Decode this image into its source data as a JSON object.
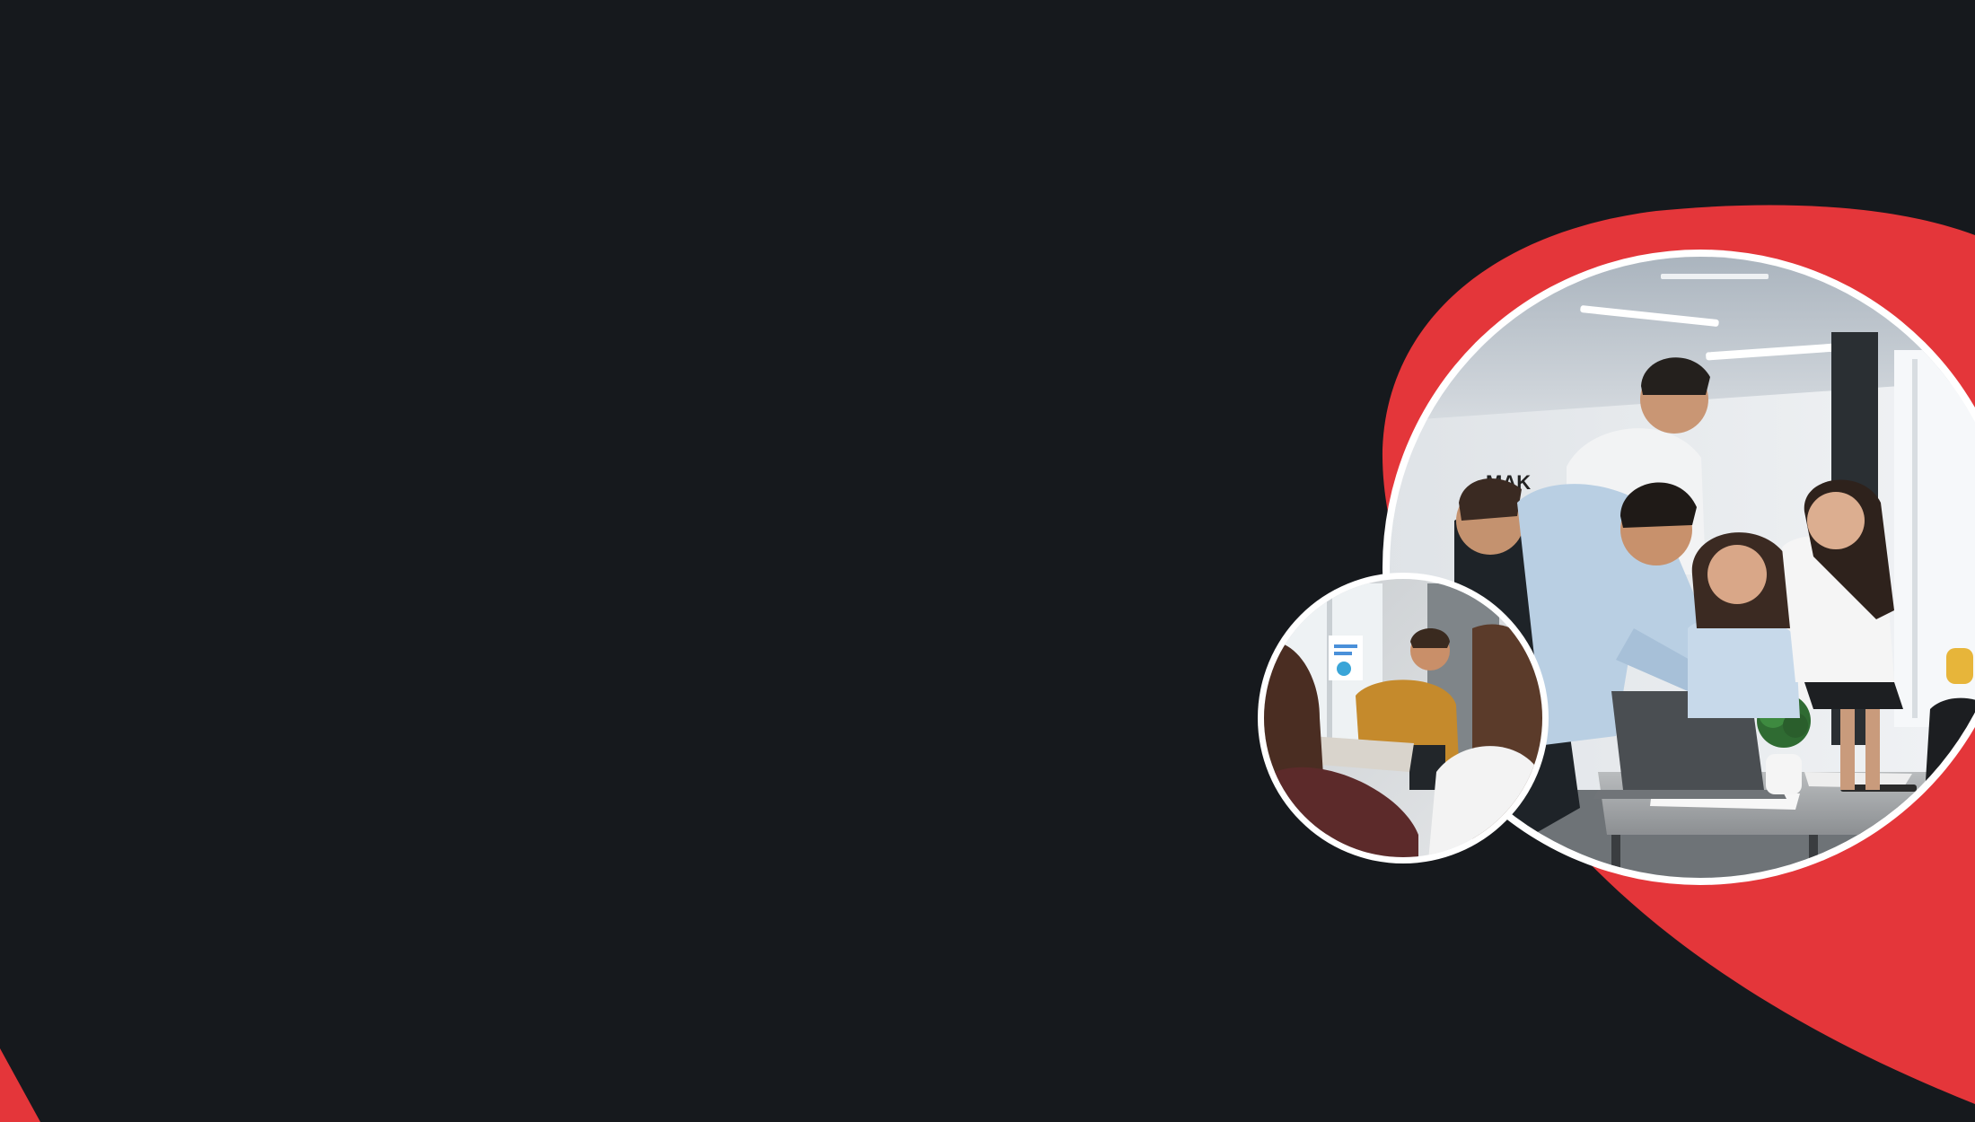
{
  "background_color": "#16191d",
  "accent_color": "#e4363a",
  "ring_color": "#ffffff",
  "images": {
    "large_photo": {
      "subject": "team-meeting-around-laptop",
      "visible_sign_text": "MAK ANT"
    },
    "small_photo": {
      "subject": "smiling-man-in-meeting"
    }
  }
}
